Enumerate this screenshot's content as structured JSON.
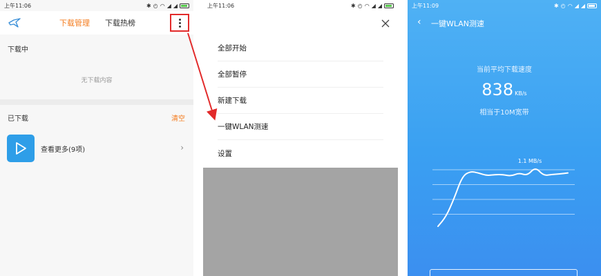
{
  "panel1": {
    "status": {
      "time": "上午11:06"
    },
    "tabs": [
      {
        "label": "下载管理"
      },
      {
        "label": "下载热榜"
      }
    ],
    "downloading": {
      "title": "下载中",
      "empty_text": "无下载内容"
    },
    "downloaded": {
      "title": "已下载",
      "clear_label": "清空",
      "more_label": "查看更多(9项)"
    }
  },
  "panel2": {
    "status": {
      "time": "上午11:06"
    },
    "menu_items": [
      {
        "label": "全部开始"
      },
      {
        "label": "全部暂停"
      },
      {
        "label": "新建下载"
      },
      {
        "label": "一键WLAN测速"
      },
      {
        "label": "设置"
      }
    ]
  },
  "panel3": {
    "status": {
      "time": "上午11:09"
    },
    "title": "一键WLAN测速",
    "speed_label": "当前平均下载速度",
    "speed_value": "838",
    "speed_unit": "KB/s",
    "equivalent": "相当于10M宽带",
    "chart_data": {
      "type": "line",
      "annotations": [
        {
          "text": "1.1 MB/s",
          "point_index": 12
        }
      ],
      "x": [
        0,
        1,
        2,
        3,
        4,
        5,
        6,
        7,
        8,
        9,
        10,
        11,
        12,
        13,
        14,
        15,
        16
      ],
      "y": [
        0.0,
        0.18,
        0.52,
        0.93,
        1.02,
        0.99,
        0.94,
        0.96,
        0.96,
        0.93,
        0.99,
        0.94,
        1.1,
        0.94,
        0.96,
        0.97,
        0.99
      ],
      "ylim": [
        0,
        1.1
      ],
      "grid": true,
      "color": "#ffffff"
    }
  },
  "colors": {
    "accent": "#f47b1d",
    "highlight": "#e22a2a",
    "speed_bg": "#3aa0f2"
  }
}
